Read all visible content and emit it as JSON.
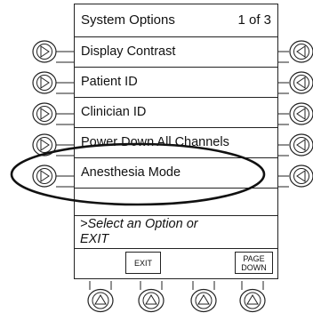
{
  "header": {
    "title": "System Options",
    "page_indicator": "1 of 3"
  },
  "options": [
    {
      "label": "Display Contrast"
    },
    {
      "label": "Patient ID"
    },
    {
      "label": "Clinician ID"
    },
    {
      "label": "Power Down All Channels"
    },
    {
      "label": "Anesthesia Mode"
    }
  ],
  "prompt": ">Select an Option or\nEXIT",
  "softkeys": {
    "exit": "EXIT",
    "page_down": "PAGE\nDOWN"
  },
  "icons": {
    "left_buttons": "play-right-icon",
    "right_buttons": "play-left-icon",
    "bottom_buttons": "play-up-icon"
  }
}
